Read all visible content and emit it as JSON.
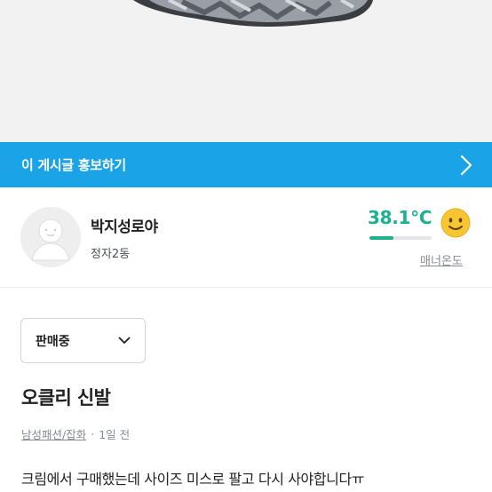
{
  "promo_bar": {
    "label": "이 게시글 홍보하기",
    "background": "#1aa3e6",
    "icon": "chevron-right-icon"
  },
  "seller": {
    "name": "박지성로야",
    "location": "정자2동",
    "avatar_icon": "default-avatar-icon",
    "manner_temp": "38.1°C",
    "manner_temp_fraction": 0.381,
    "manner_label": "매너온도",
    "temp_color": "#1ab18f",
    "face_icon": "smiley-face-icon"
  },
  "status_select": {
    "selected": "판매중",
    "icon": "chevron-down-icon"
  },
  "item": {
    "title": "오클리 신발",
    "category": "남성패션/잡화",
    "separator": "·",
    "time_ago": "1일 전",
    "description": "크림에서 구매했는데 사이즈 미스로 팔고 다시 사야합니다ㅠ"
  }
}
